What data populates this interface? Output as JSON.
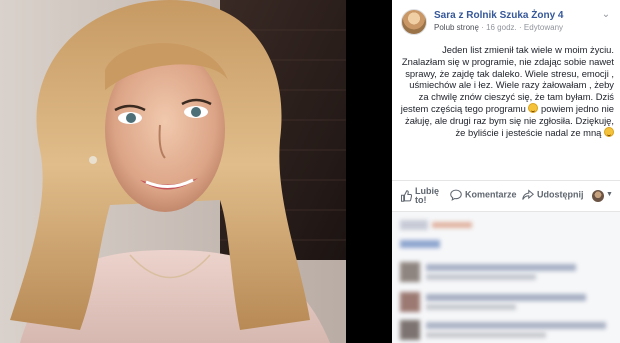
{
  "post": {
    "page_name": "Sara z Rolnik Szuka Żony 4",
    "like_page": "Polub stronę",
    "time": "16 godz.",
    "edited": "Edytowany",
    "separator": "·",
    "body_parts": [
      "Jeden list zmienił tak wiele w moim życiu. Znalazłam się w programie, nie zdając sobie nawet sprawy, że zajdę tak daleko. Wiele stresu, emocji , uśmiechów ale i łez. Wiele razy żałowałam , żeby za chwilę znów cieszyć się, że tam byłam. Dziś jestem częścią tego programu ",
      " powiem jedno nie żałuję, ale drugi raz bym się nie zgłosiła. Dziękuję, że byliście i jesteście nadal ze mną "
    ]
  },
  "actions": {
    "like": "Lubię to!",
    "comment": "Komentarze",
    "share": "Udostępnij"
  },
  "colors": {
    "link": "#365899",
    "meta": "#90949c",
    "action": "#606770",
    "comments_bg": "#f6f7f9"
  },
  "icons": [
    "chevron-down-icon",
    "thumbs-up-icon",
    "comment-icon",
    "share-icon",
    "smile-emoji-icon"
  ]
}
